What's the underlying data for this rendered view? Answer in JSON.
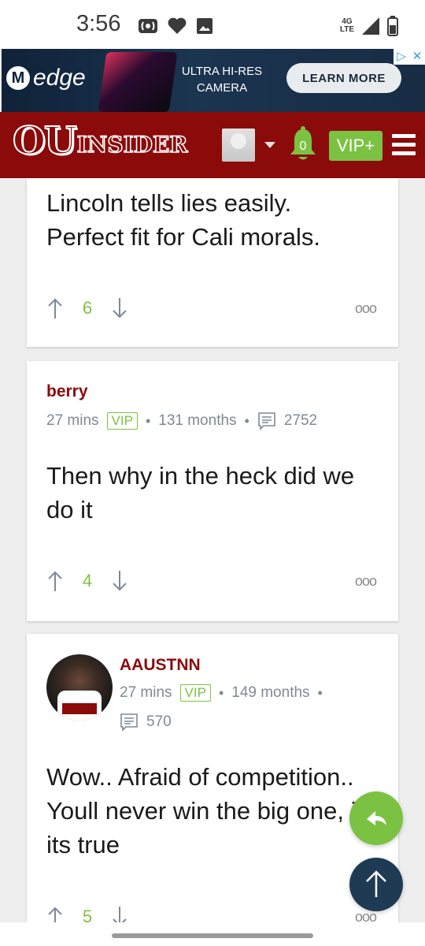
{
  "status_bar": {
    "time": "3:56",
    "network": "4G\nLTE",
    "icons": [
      "hotspot-icon",
      "heart-icon",
      "image-icon",
      "signal-icon",
      "battery-icon"
    ]
  },
  "ad": {
    "brand": "edge",
    "tagline": "ULTRA HI-RES\nCAMERA",
    "cta": "LEARN MORE"
  },
  "navbar": {
    "logo_prefix": "OU",
    "logo_suffix": "INSIDER",
    "notification_count": "0",
    "vip_label": "VIP+",
    "colors": {
      "brand": "#8b0a0a",
      "accent": "#7cc242"
    }
  },
  "comments": [
    {
      "author": "",
      "text": "Lincoln tells lies easily.\nPerfect fit for Cali morals.",
      "votes": "6"
    },
    {
      "author": "berry",
      "time": "27 mins",
      "badge": "VIP",
      "tenure": "131 months",
      "posts": "2752",
      "text": "Then why in the heck did we do it",
      "votes": "4"
    },
    {
      "author": "AAUSTNN",
      "time": "27 mins",
      "badge": "VIP",
      "tenure": "149 months",
      "posts": "570",
      "text": "Wow.. Afraid of competition.. Youll never win the big one, if its true",
      "votes": "5"
    }
  ],
  "more_glyph": "ooo"
}
